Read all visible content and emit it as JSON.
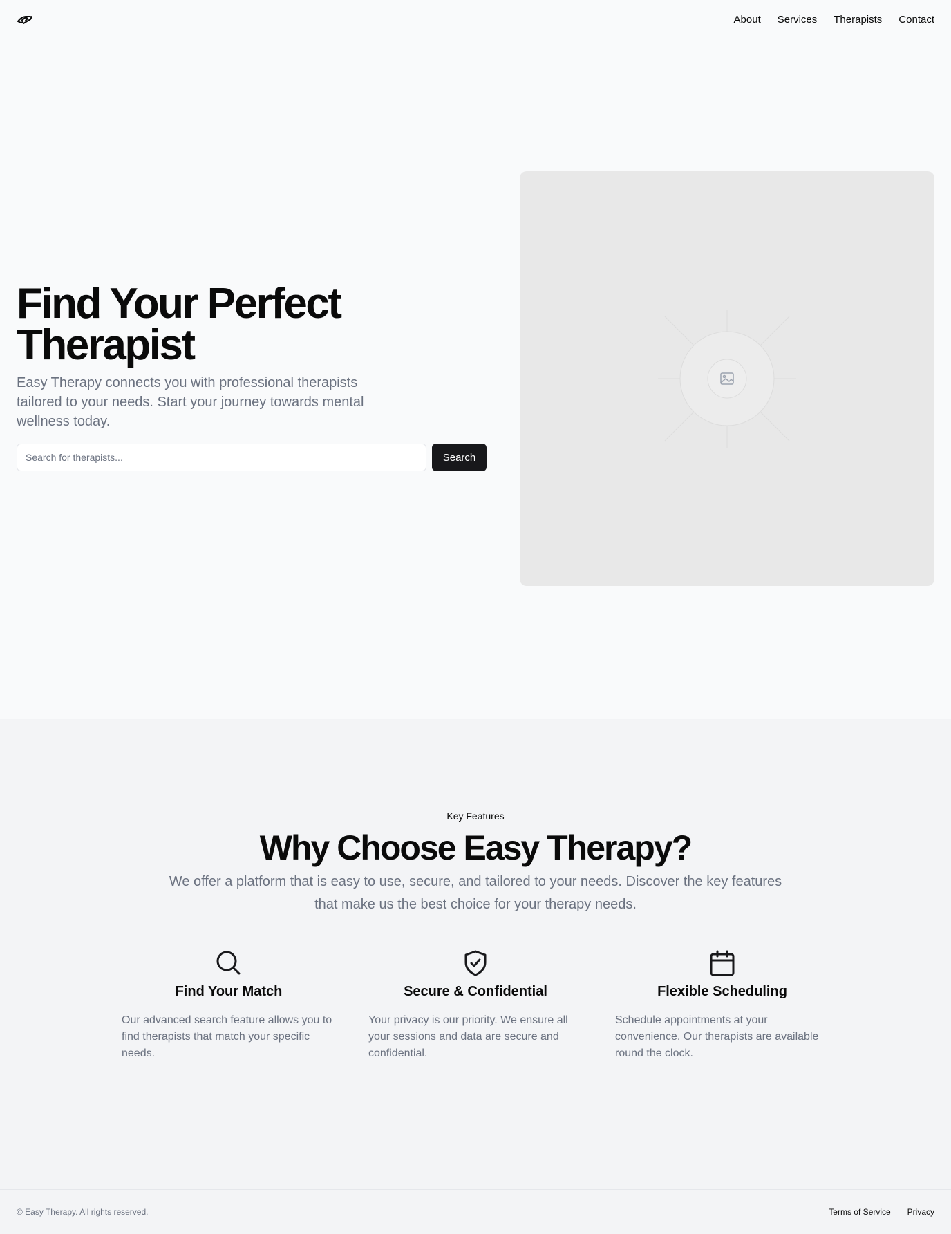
{
  "header": {
    "logo_icon": "handshake-icon",
    "nav": [
      "About",
      "Services",
      "Therapists",
      "Contact"
    ]
  },
  "hero": {
    "title": "Find Your Perfect Therapist",
    "description": "Easy Therapy connects you with professional therapists tailored to your needs. Start your journey towards mental wellness today.",
    "search_placeholder": "Search for therapists...",
    "search_button": "Search",
    "image_icon": "image-placeholder-icon"
  },
  "features": {
    "kicker": "Key Features",
    "title": "Why Choose Easy Therapy?",
    "description": "We offer a platform that is easy to use, secure, and tailored to your needs. Discover the key features that make us the best choice for your therapy needs.",
    "items": [
      {
        "icon": "search-icon",
        "title": "Find Your Match",
        "description": "Our advanced search feature allows you to find therapists that match your specific needs."
      },
      {
        "icon": "shield-check-icon",
        "title": "Secure & Confidential",
        "description": "Your privacy is our priority. We ensure all your sessions and data are secure and confidential."
      },
      {
        "icon": "calendar-icon",
        "title": "Flexible Scheduling",
        "description": "Schedule appointments at your convenience. Our therapists are available round the clock."
      }
    ]
  },
  "footer": {
    "copyright": "© Easy Therapy. All rights reserved.",
    "links": [
      "Terms of Service",
      "Privacy"
    ]
  }
}
